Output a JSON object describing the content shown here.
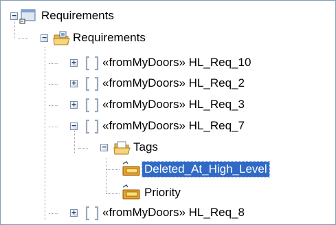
{
  "tree": {
    "root": {
      "label": "Requirements",
      "icon": "model-root-icon",
      "expanded": true
    },
    "package": {
      "label": "Requirements",
      "icon": "open-package-folder-icon",
      "expanded": true
    },
    "items": [
      {
        "stereotype": "«fromMyDoors»",
        "name": "HL_Req_10",
        "expanded": false,
        "icon": "requirement-bracket-icon"
      },
      {
        "stereotype": "«fromMyDoors»",
        "name": "HL_Req_2",
        "expanded": false,
        "icon": "requirement-bracket-icon"
      },
      {
        "stereotype": "«fromMyDoors»",
        "name": "HL_Req_3",
        "expanded": false,
        "icon": "requirement-bracket-icon"
      },
      {
        "stereotype": "«fromMyDoors»",
        "name": "HL_Req_7",
        "expanded": true,
        "icon": "requirement-bracket-icon"
      },
      {
        "stereotype": "«fromMyDoors»",
        "name": "HL_Req_8",
        "expanded": false,
        "icon": "requirement-bracket-icon"
      }
    ],
    "tags_folder": {
      "label": "Tags",
      "icon": "open-folder-icon",
      "expanded": true
    },
    "tags": [
      {
        "label": "Deleted_At_High_Level",
        "selected": true,
        "icon": "tag-icon"
      },
      {
        "label": "Priority",
        "selected": false,
        "icon": "tag-icon"
      }
    ]
  },
  "colors": {
    "selection": "#316ac5",
    "folder": "#f4c85a",
    "requirement_bracket": "#9aa9bb",
    "tag": "#e8a02a"
  }
}
